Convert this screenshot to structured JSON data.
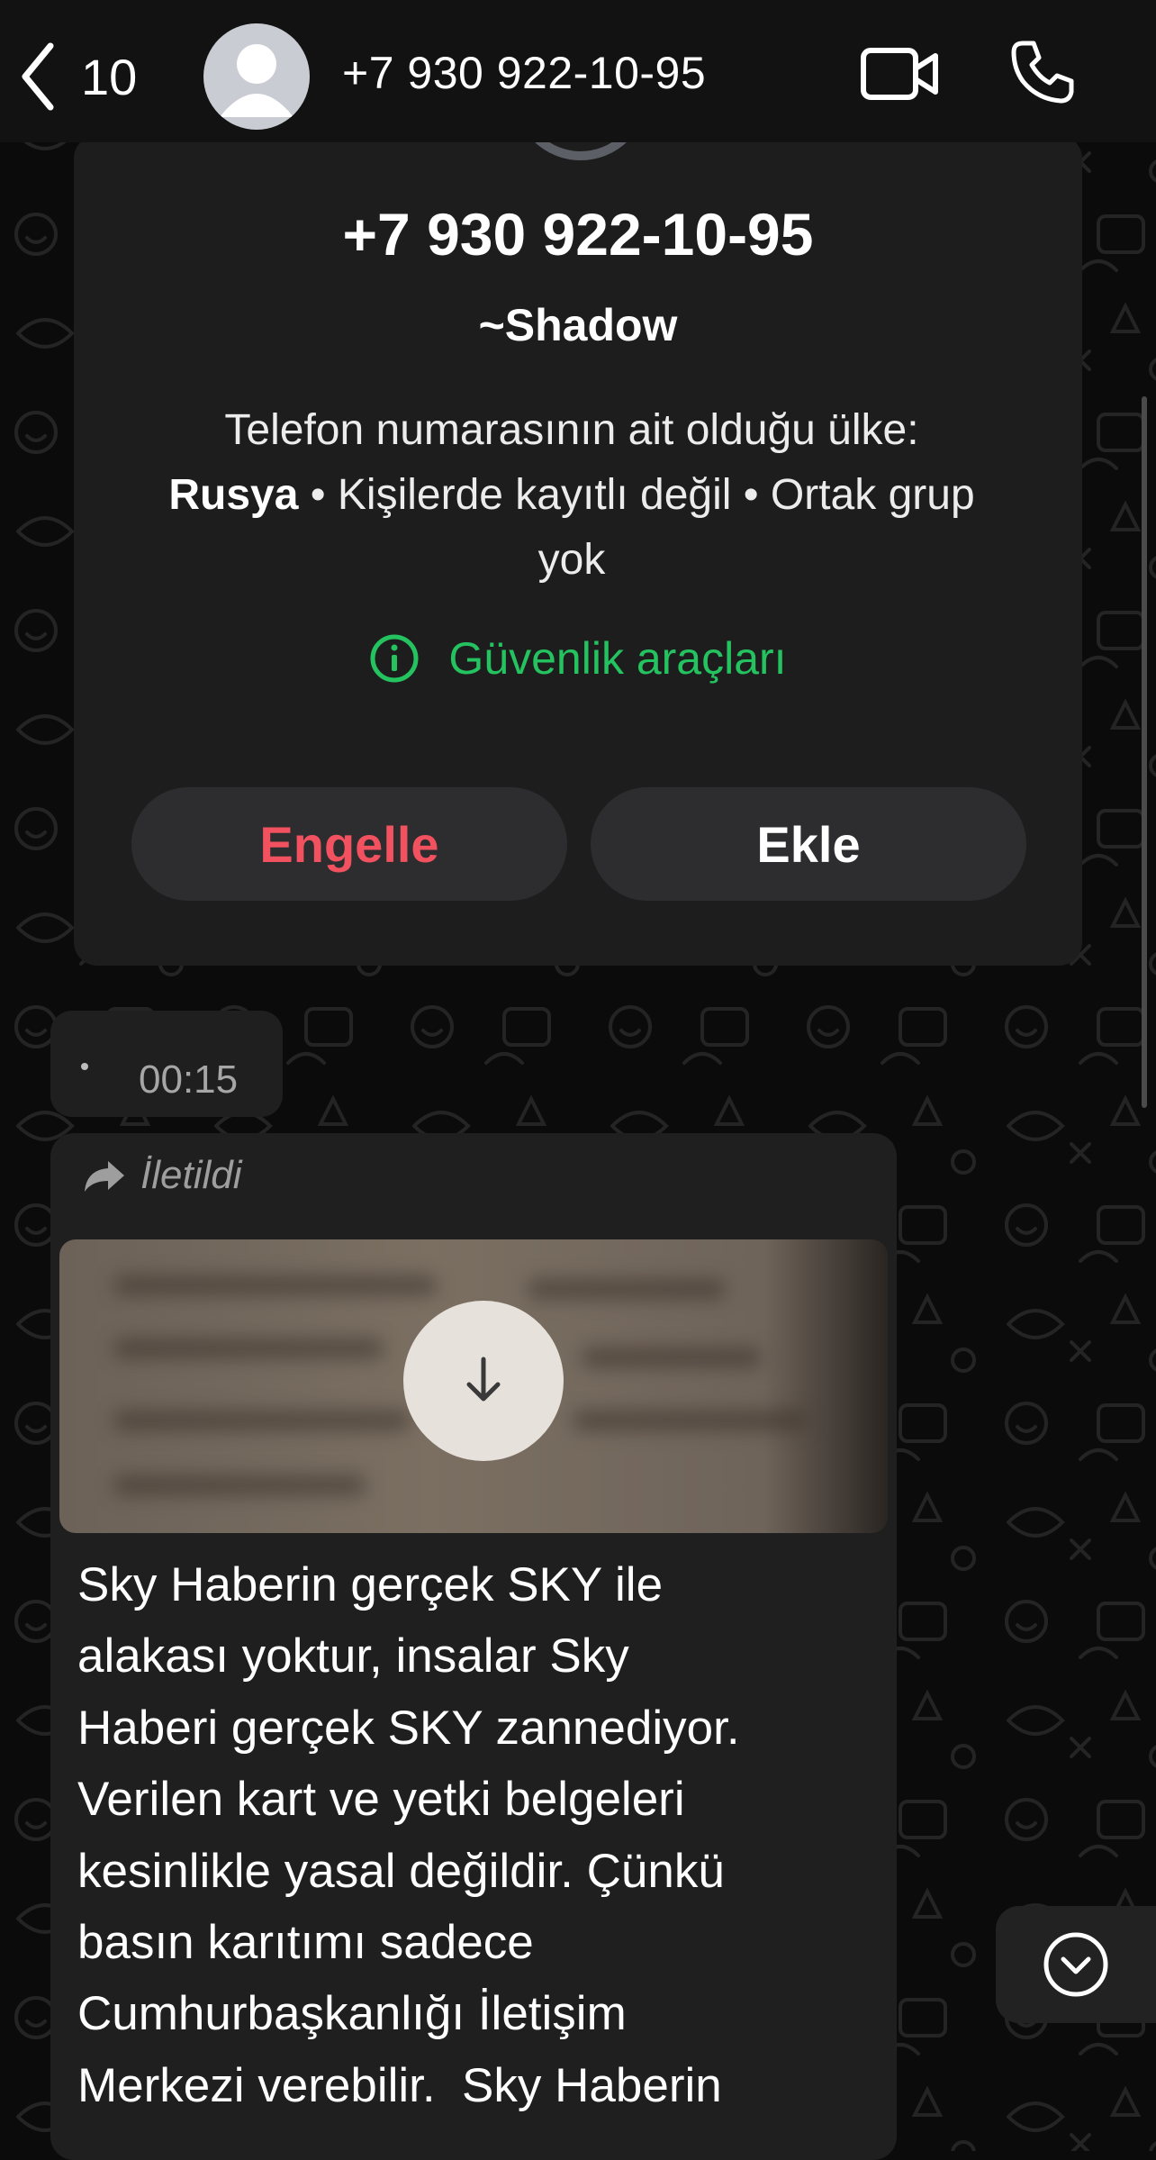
{
  "header": {
    "back_count": "10",
    "title": "+7 930 922-10-95"
  },
  "contact_card": {
    "number": "+7 930 922-10-95",
    "name": "~Shadow",
    "info_line1": "Telefon numarasının ait olduğu ülke:",
    "country": "Rusya",
    "info_rest": " • Kişilerde kayıtlı değil • Ortak grup yok",
    "security_link": "Güvenlik araçları",
    "block_label": "Engelle",
    "add_label": "Ekle"
  },
  "voice_message": {
    "duration": "00:15"
  },
  "forwarded_message": {
    "forwarded_label": "İletildi",
    "text": "Sky Haberin gerçek SKY ile\nalakası yoktur, insalar Sky\nHaberi gerçek SKY zannediyor.\nVerilen kart ve yetki belgeleri\nkesinlikle yasal değildir. Çünkü\nbasın karıtımı sadece\nCumhurbaşkanlığı İletişim\nMerkezi verebilir.  Sky Haberin"
  },
  "colors": {
    "header_bg": "#121212",
    "card_bg": "#1d1d1e",
    "accent_green": "#25c260",
    "block_red": "#f2515f",
    "bubble_bg": "#1f1f1f"
  },
  "icons": {
    "back": "chevron-left-icon",
    "avatar": "person-icon",
    "video": "video-camera-icon",
    "call": "phone-icon",
    "info": "info-icon",
    "forward": "forward-arrow-icon",
    "download": "download-arrow-icon",
    "scroll_down": "chevron-down-circle-icon"
  }
}
